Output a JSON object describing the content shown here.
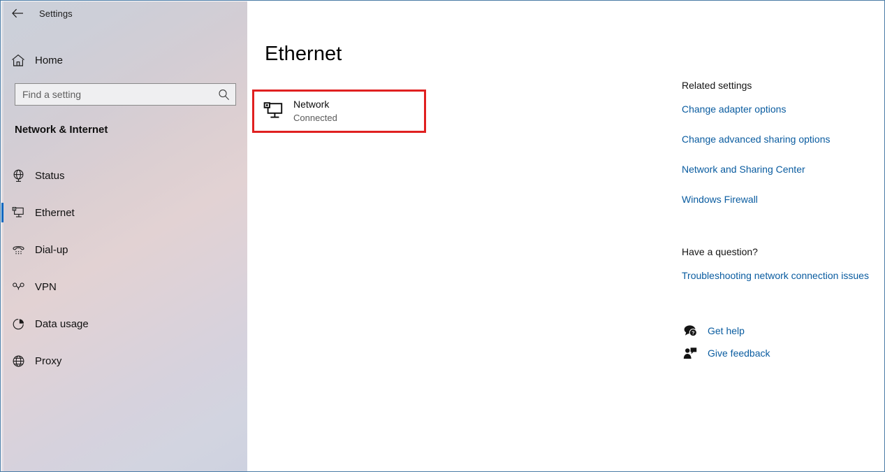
{
  "window": {
    "app_title": "Settings",
    "back_icon": "back-arrow-icon",
    "controls": {
      "minimize": "minimize-icon",
      "maximize": "maximize-icon",
      "close": "close-icon"
    }
  },
  "sidebar": {
    "home_label": "Home",
    "home_icon": "home-icon",
    "search": {
      "placeholder": "Find a setting",
      "value": "",
      "icon": "search-icon"
    },
    "category_title": "Network & Internet",
    "items": [
      {
        "label": "Status",
        "icon": "globe-monitor-icon",
        "selected": false
      },
      {
        "label": "Ethernet",
        "icon": "ethernet-monitor-icon",
        "selected": true
      },
      {
        "label": "Dial-up",
        "icon": "dialup-phone-icon",
        "selected": false
      },
      {
        "label": "VPN",
        "icon": "vpn-key-icon",
        "selected": false
      },
      {
        "label": "Data usage",
        "icon": "pie-chart-icon",
        "selected": false
      },
      {
        "label": "Proxy",
        "icon": "globe-icon",
        "selected": false
      }
    ]
  },
  "main": {
    "page_title": "Ethernet",
    "network_card": {
      "title": "Network",
      "status": "Connected",
      "icon": "network-monitor-icon",
      "highlight_color": "#e02020"
    }
  },
  "rail": {
    "related_heading": "Related settings",
    "related_links": [
      "Change adapter options",
      "Change advanced sharing options",
      "Network and Sharing Center",
      "Windows Firewall"
    ],
    "question_heading": "Have a question?",
    "question_links": [
      "Troubleshooting network connection issues"
    ],
    "help_items": [
      {
        "label": "Get help",
        "icon": "help-bubble-icon"
      },
      {
        "label": "Give feedback",
        "icon": "feedback-person-icon"
      }
    ]
  },
  "colors": {
    "link": "#0a5ca0",
    "accent": "#0067c0",
    "highlight": "#e02020"
  }
}
